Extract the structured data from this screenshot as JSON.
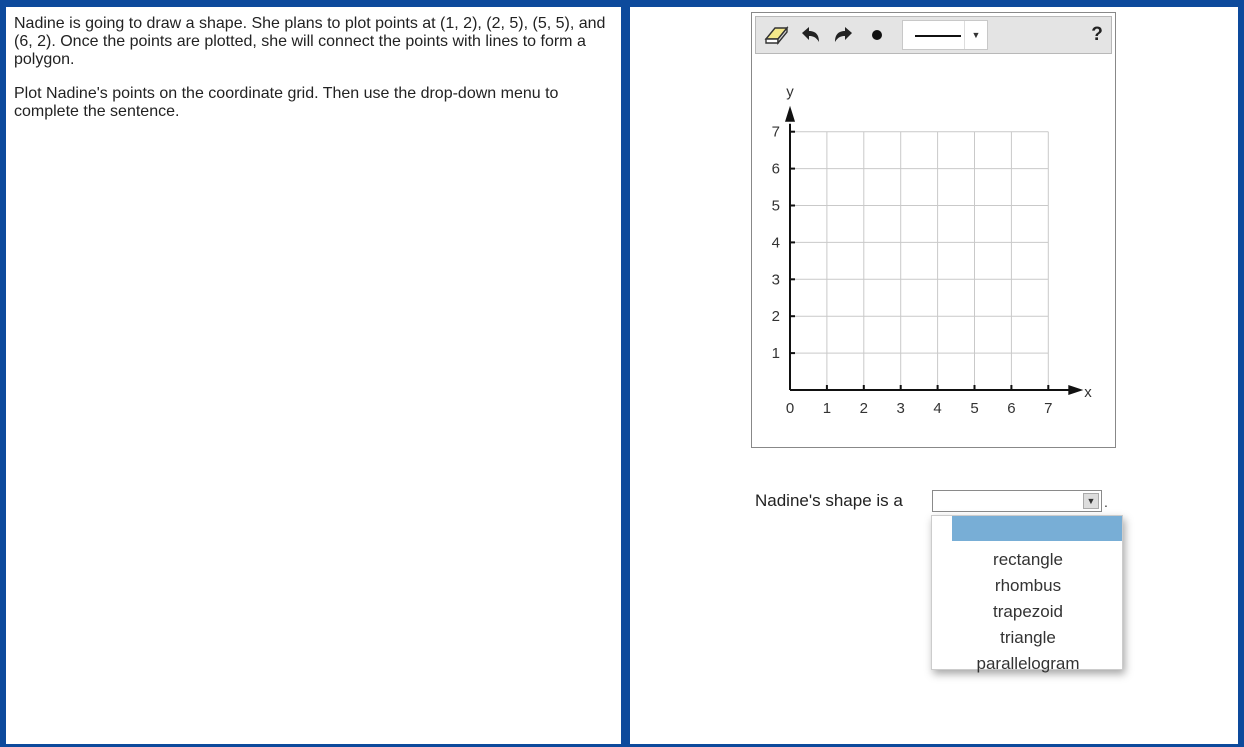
{
  "prompt": {
    "paragraph1": "Nadine is going to draw a shape. She plans to plot points at (1, 2), (2, 5), (5, 5), and (6, 2). Once the points are plotted, she will connect the points with lines to form a polygon.",
    "paragraph2": "Plot Nadine's points on the coordinate grid. Then use the drop-down menu to complete the sentence."
  },
  "toolbar": {
    "tools": [
      {
        "icon": "eraser-icon"
      },
      {
        "icon": "undo-icon"
      },
      {
        "icon": "redo-icon"
      },
      {
        "icon": "point-tool-icon"
      },
      {
        "icon": "line-tool-icon"
      }
    ],
    "help_label": "?"
  },
  "graph": {
    "x_axis_label": "x",
    "y_axis_label": "y",
    "x_range": [
      0,
      7
    ],
    "y_range": [
      0,
      7
    ],
    "x_tick_labels": [
      "0",
      "1",
      "2",
      "3",
      "4",
      "5",
      "6",
      "7"
    ],
    "y_tick_labels": [
      "1",
      "2",
      "3",
      "4",
      "5",
      "6",
      "7"
    ],
    "grid": true
  },
  "question": {
    "sentence": "Nadine's shape is a",
    "selected_value": "",
    "period": ".",
    "options": [
      "rectangle",
      "rhombus",
      "trapezoid",
      "triangle",
      "parallelogram"
    ],
    "highlight_color": "#78aed6"
  }
}
